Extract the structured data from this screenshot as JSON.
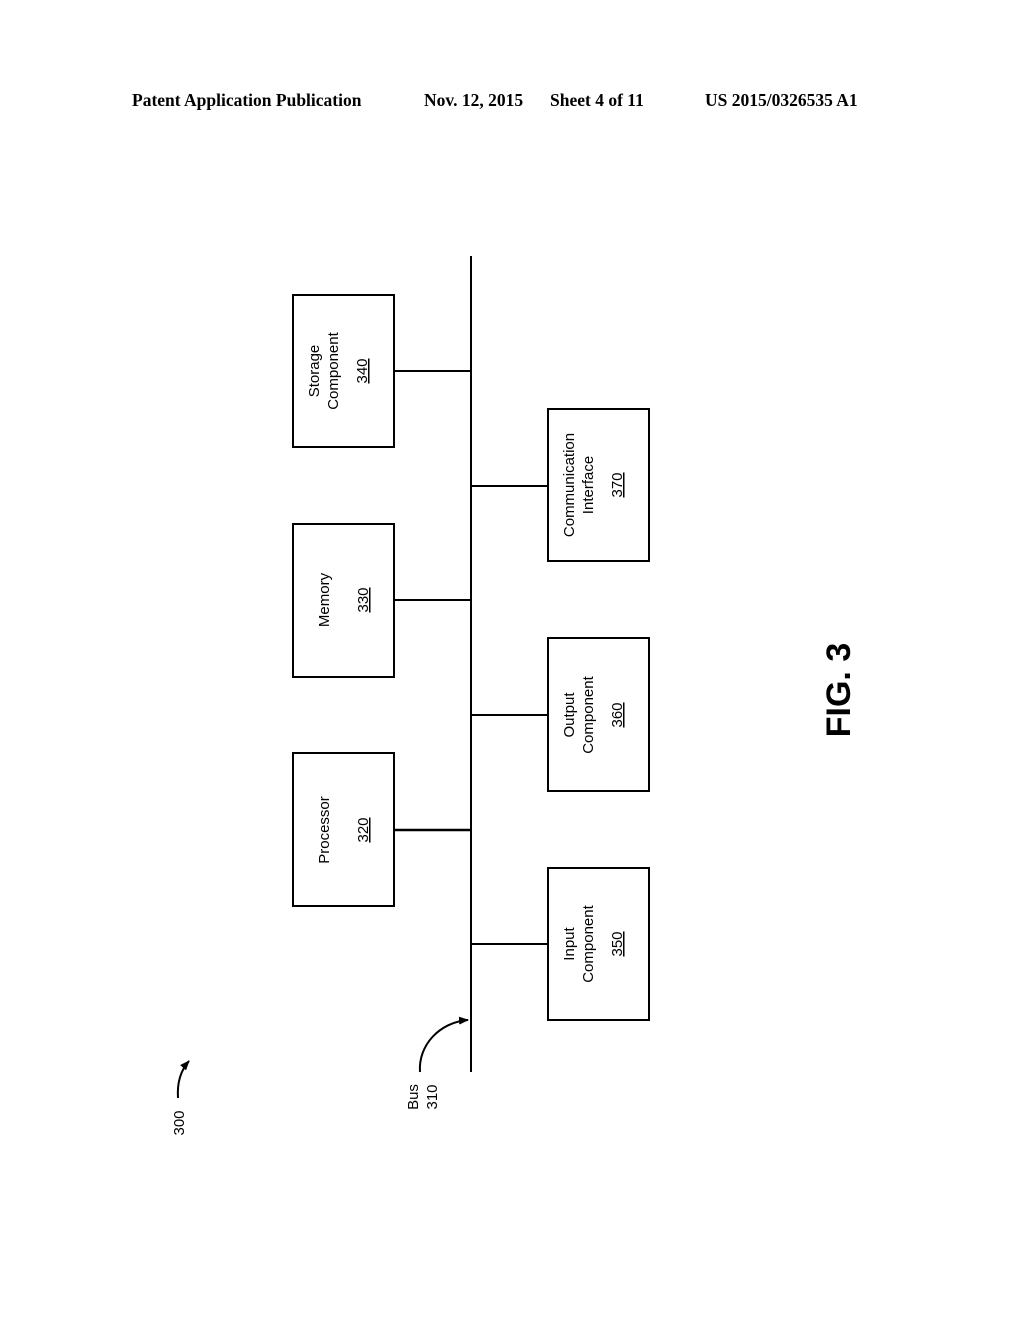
{
  "header": {
    "publication_type": "Patent Application Publication",
    "date": "Nov. 12, 2015",
    "sheet": "Sheet 4 of 11",
    "publication_number": "US 2015/0326535 A1"
  },
  "figure": {
    "label": "FIG. 3",
    "reference": "300"
  },
  "bus": {
    "label": "Bus",
    "number": "310"
  },
  "components": [
    {
      "id": "processor",
      "lines": [
        "Processor"
      ],
      "number": "320"
    },
    {
      "id": "memory",
      "lines": [
        "Memory"
      ],
      "number": "330"
    },
    {
      "id": "storage",
      "lines": [
        "Storage",
        "Component"
      ],
      "number": "340"
    },
    {
      "id": "input",
      "lines": [
        "Input",
        "Component"
      ],
      "number": "350"
    },
    {
      "id": "output",
      "lines": [
        "Output",
        "Component"
      ],
      "number": "360"
    },
    {
      "id": "communication",
      "lines": [
        "Communication",
        "Interface"
      ],
      "number": "370"
    }
  ]
}
